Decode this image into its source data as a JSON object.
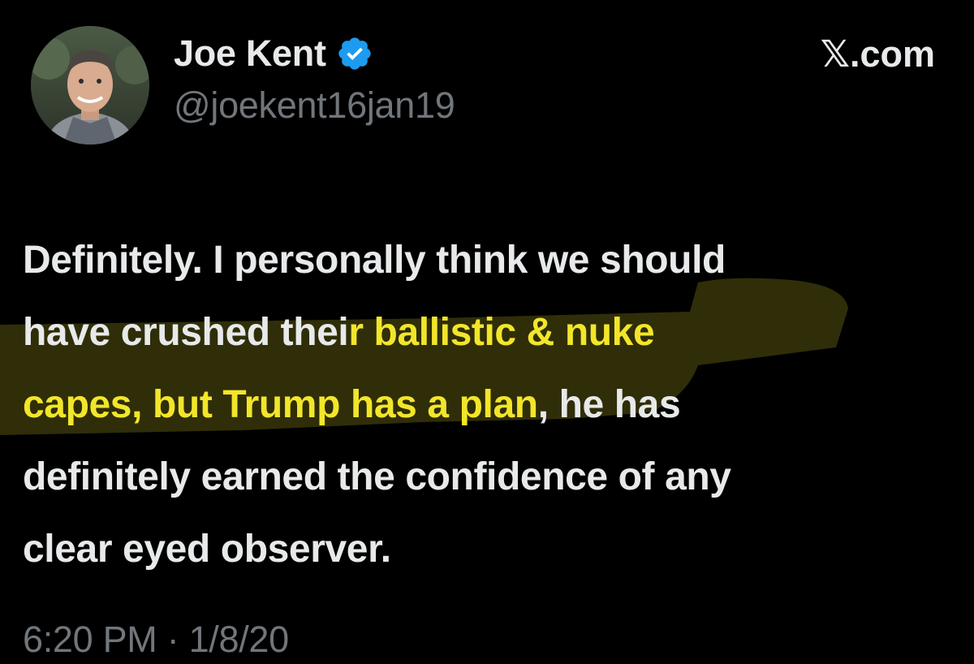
{
  "author": {
    "display_name": "Joe Kent",
    "handle": "@joekent16jan19",
    "verified": true,
    "avatar_icon": "profile-photo"
  },
  "source_label": "𝕏.com",
  "tweet": {
    "lines": [
      {
        "plain": "Definitely. I personally think we should",
        "highlight": "",
        "after": ""
      },
      {
        "plain": "have crushed thei",
        "highlight": "r ballistic & nuke",
        "after": ""
      },
      {
        "plain": "",
        "highlight": "capes, but Trump has a plan",
        "after": ", he has"
      },
      {
        "plain": "definitely earned the confidence of any",
        "highlight": "",
        "after": ""
      },
      {
        "plain": "clear eyed observer.",
        "highlight": "",
        "after": ""
      }
    ]
  },
  "timestamp": "6:20 PM · 1/8/20",
  "colors": {
    "background": "#000000",
    "text": "#e7e9ea",
    "secondary": "#71767b",
    "verified_blue": "#1d9bf0",
    "highlighter": "#f2e62a"
  }
}
